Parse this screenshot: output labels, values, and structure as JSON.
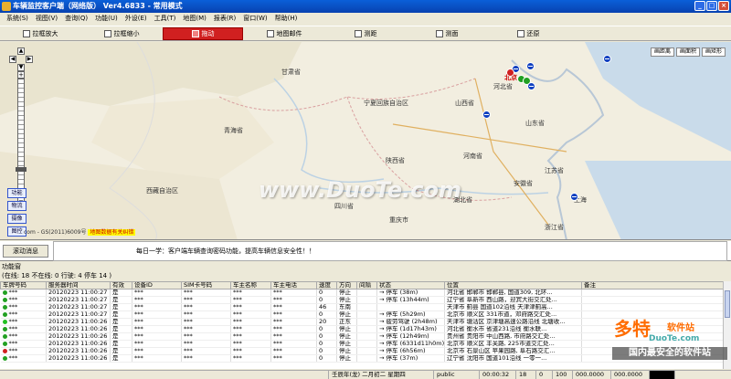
{
  "window": {
    "title": "车辆监控客户端（网络版） Ver4.6833 - 常用模式"
  },
  "menu": [
    "系统(S)",
    "视图(V)",
    "查询(Q)",
    "功能(U)",
    "外设(E)",
    "工具(T)",
    "地图(M)",
    "报表(R)",
    "窗口(W)",
    "帮助(H)"
  ],
  "toolbar": [
    {
      "label": "拉框放大",
      "active": false
    },
    {
      "label": "拉框缩小",
      "active": false
    },
    {
      "label": "拖动",
      "active": true
    },
    {
      "label": "地图邮件",
      "active": false
    },
    {
      "label": "测距",
      "active": false
    },
    {
      "label": "测面",
      "active": false
    },
    {
      "label": "还原",
      "active": false
    }
  ],
  "map": {
    "view_buttons": [
      "画距离",
      "画面积",
      "画矩形"
    ],
    "side_buttons": [
      "功能",
      "物流",
      "摄像",
      "图控"
    ],
    "copyright": "com - GS(2011)6009号",
    "warning": "地图数据有关纠错",
    "watermark": "www.DuoTe.com",
    "labels": {
      "gansu": "甘肃省",
      "ningxia": "宁夏回族自治区",
      "qinghai": "青海省",
      "shaanxi": "陕西省",
      "shanxi": "山西省",
      "hebei": "河北省",
      "shandong": "山东省",
      "henan": "河南省",
      "jiangsu": "江苏省",
      "anhui": "安徽省",
      "hubei": "湖北省",
      "sichuan": "四川省",
      "xizang": "西藏自治区",
      "zhejiang": "浙江省",
      "chongqing": "重庆市",
      "beijing": "北京",
      "shanghai": "上海"
    }
  },
  "message": {
    "button": "滚动消息",
    "text": "每日一学：客户端车辆查询密码功能，提高车辆信息安全性！！"
  },
  "panel": {
    "tab": "功能窗",
    "stats": "(在线: 18 不在线: 0 行驶: 4 停车 14 )"
  },
  "table": {
    "headers": [
      "车牌号码",
      "服务器时间",
      "有效",
      "设备ID",
      "SIM卡号码",
      "车主名称",
      "车主电话",
      "速度",
      "方向",
      "间隔",
      "状态",
      "位置",
      "备注"
    ],
    "rows": [
      {
        "dot": "#22a022",
        "plate": "***",
        "time": "20120223 11:00:27",
        "valid": "是",
        "dev": "***",
        "sim": "***",
        "owner": "***",
        "phone": "***",
        "speed": "0",
        "dir": "停止",
        "gap": "",
        "status": "→ 停车 (38m)",
        "pos": "河北省 邯郸市 邯郸县, 国道309, 北环..."
      },
      {
        "dot": "#22a022",
        "plate": "***",
        "time": "20120223 11:00:27",
        "valid": "是",
        "dev": "***",
        "sim": "***",
        "owner": "***",
        "phone": "***",
        "speed": "0",
        "dir": "停止",
        "gap": "",
        "status": "→ 停车 (13h44m)",
        "pos": "辽宁省 阜新市 西山路，迎宾大街交汇处..."
      },
      {
        "dot": "#22a022",
        "plate": "***",
        "time": "20120223 11:00:27",
        "valid": "是",
        "dev": "***",
        "sim": "***",
        "owner": "***",
        "phone": "***",
        "speed": "46",
        "dir": "东南",
        "gap": "",
        "status": "",
        "pos": "天津市 蓟县 国道102沿线 天津津蓟高..."
      },
      {
        "dot": "#22a022",
        "plate": "***",
        "time": "20120223 11:00:27",
        "valid": "是",
        "dev": "***",
        "sim": "***",
        "owner": "***",
        "phone": "***",
        "speed": "0",
        "dir": "停止",
        "gap": "",
        "status": "→ 停车 (5h29m)",
        "pos": "北京市 顺义区 331市道，邓府路交汇处..."
      },
      {
        "dot": "#22c022",
        "plate": "***",
        "time": "20120223 11:00:26",
        "valid": "是",
        "dev": "***",
        "sim": "***",
        "owner": "***",
        "phone": "***",
        "speed": "20",
        "dir": "正东",
        "gap": "",
        "status": "→ 疲劳驾驶 (2h48m)",
        "pos": "天津市 塘沽区 京津塘高速公路沿线 北塘收..."
      },
      {
        "dot": "#22a022",
        "plate": "***",
        "time": "20120223 11:00:26",
        "valid": "是",
        "dev": "***",
        "sim": "***",
        "owner": "***",
        "phone": "***",
        "speed": "0",
        "dir": "停止",
        "gap": "",
        "status": "→ 停车 (1d17h43m)",
        "pos": "河北省 衡水市 省道231沿线 衡水联..."
      },
      {
        "dot": "#22a022",
        "plate": "***",
        "time": "20120223 11:00:26",
        "valid": "是",
        "dev": "***",
        "sim": "***",
        "owner": "***",
        "phone": "***",
        "speed": "0",
        "dir": "停止",
        "gap": "",
        "status": "→ 停车 (12h49m)",
        "pos": "贵州省 贵阳市 中山西路, 市府路交汇处..."
      },
      {
        "dot": "#22a022",
        "plate": "***",
        "time": "20120223 11:00:26",
        "valid": "是",
        "dev": "***",
        "sim": "***",
        "owner": "***",
        "phone": "***",
        "speed": "0",
        "dir": "停止",
        "gap": "",
        "status": "→ 停车 (6331d11h0m)",
        "pos": "北京市 顺义区 丰关路, 225市道交汇处..."
      },
      {
        "dot": "#d02020",
        "plate": "***",
        "time": "20120223 11:00:26",
        "valid": "是",
        "dev": "***",
        "sim": "***",
        "owner": "***",
        "phone": "***",
        "speed": "0",
        "dir": "停止",
        "gap": "",
        "status": "→ 停车 (6h56m)",
        "pos": "北京市 石景山区 苹果园路, 阜石路交汇..."
      },
      {
        "dot": "#22a022",
        "plate": "***",
        "time": "20120223 11:00:26",
        "valid": "是",
        "dev": "***",
        "sim": "***",
        "owner": "***",
        "phone": "***",
        "speed": "0",
        "dir": "停止",
        "gap": "",
        "status": "→ 停车 (37m)",
        "pos": "辽宁省 沈阳市 国道101沿线 一零一..."
      }
    ]
  },
  "status": {
    "date": "壬辰年(龙) 二月初二 星期四",
    "user": "public",
    "time": "00:00:32",
    "a": "18",
    "b": "0",
    "c": "100",
    "d": "000.0000",
    "e": "000.0000"
  },
  "brand_watermark": {
    "t1": "多特",
    "t1s": "软件站",
    "t2": "DuoTe.com",
    "t3": "国内最安全的软件站"
  }
}
